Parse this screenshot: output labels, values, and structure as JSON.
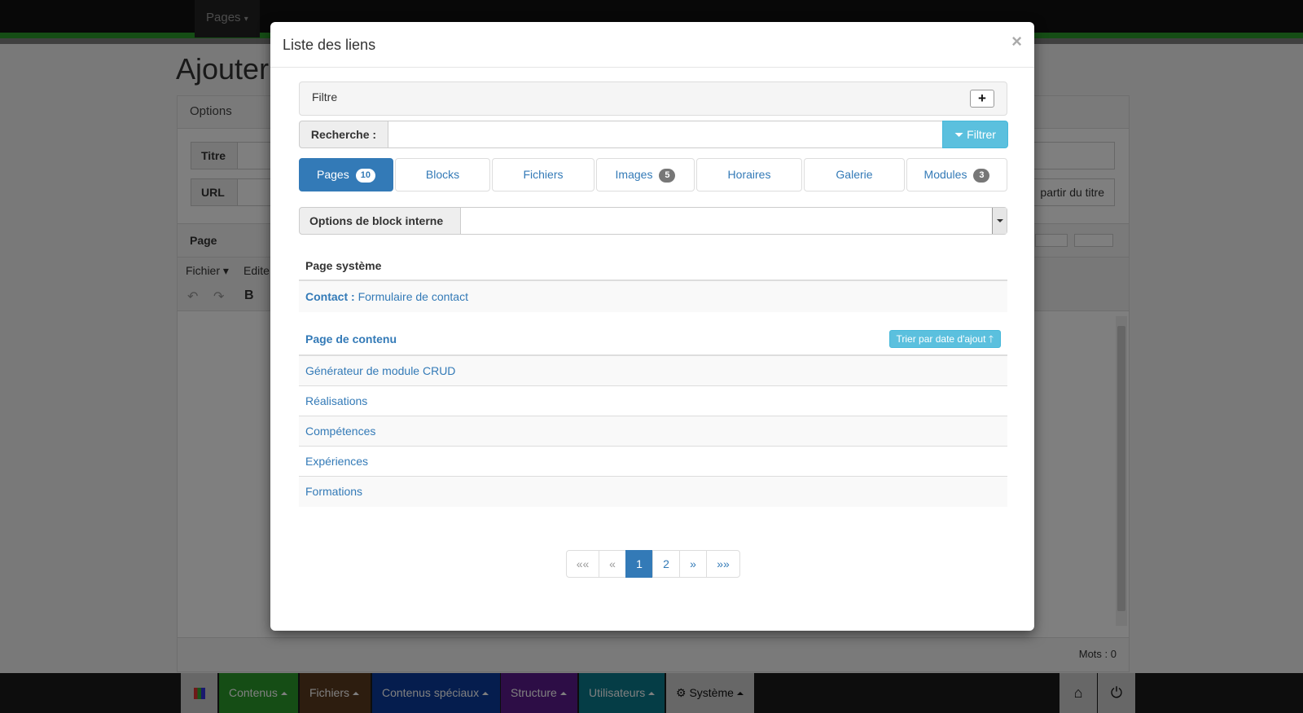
{
  "background": {
    "top_menu": "Pages",
    "page_title": "Ajouter",
    "options_panel": "Options",
    "title_label": "Titre",
    "url_label": "URL",
    "from_title_button": "partir du titre",
    "editor_label": "Page",
    "editor_menu": [
      "Fichier",
      "Edite"
    ],
    "word_count": "Mots : 0"
  },
  "bottom_bar": {
    "items": [
      {
        "label": "Contenus",
        "color": "#2a9a2a"
      },
      {
        "label": "Fichiers",
        "color": "#5b3a1e"
      },
      {
        "label": "Contenus spéciaux",
        "color": "#0a3a9c"
      },
      {
        "label": "Structure",
        "color": "#5a1a8c"
      },
      {
        "label": "Utilisateurs",
        "color": "#0a7a8c"
      },
      {
        "label": "Système",
        "color": "#cfcfcf"
      }
    ],
    "icons": [
      "grid-icon",
      "home-icon",
      "power-icon"
    ]
  },
  "modal": {
    "title": "Liste des liens",
    "close": "×",
    "filter": {
      "label": "Filtre",
      "toggle": "+",
      "search_label": "Recherche :",
      "search_value": "",
      "button": "Filtrer"
    },
    "tabs": [
      {
        "label": "Pages",
        "badge": "10",
        "active": true
      },
      {
        "label": "Blocks",
        "badge": ""
      },
      {
        "label": "Fichiers",
        "badge": ""
      },
      {
        "label": "Images",
        "badge": "5"
      },
      {
        "label": "Horaires",
        "badge": ""
      },
      {
        "label": "Galerie",
        "badge": ""
      },
      {
        "label": "Modules",
        "badge": "3"
      }
    ],
    "block_options_label": "Options de block interne",
    "system_section": {
      "title": "Page système",
      "rows": [
        {
          "name": "Contact",
          "separator": " : ",
          "desc": "Formulaire de contact"
        }
      ]
    },
    "content_section": {
      "title": "Page de contenu",
      "sort_button": "Trier par date d'ajout",
      "rows": [
        "Générateur de module CRUD",
        "Réalisations",
        "Compétences",
        "Expériences",
        "Formations"
      ]
    },
    "pagination": [
      "««",
      "«",
      "1",
      "2",
      "»",
      "»»"
    ],
    "current_page": "1"
  },
  "colors": {
    "primary": "#337ab7",
    "info": "#5bc0de",
    "success_bar": "#2a9a2a"
  }
}
